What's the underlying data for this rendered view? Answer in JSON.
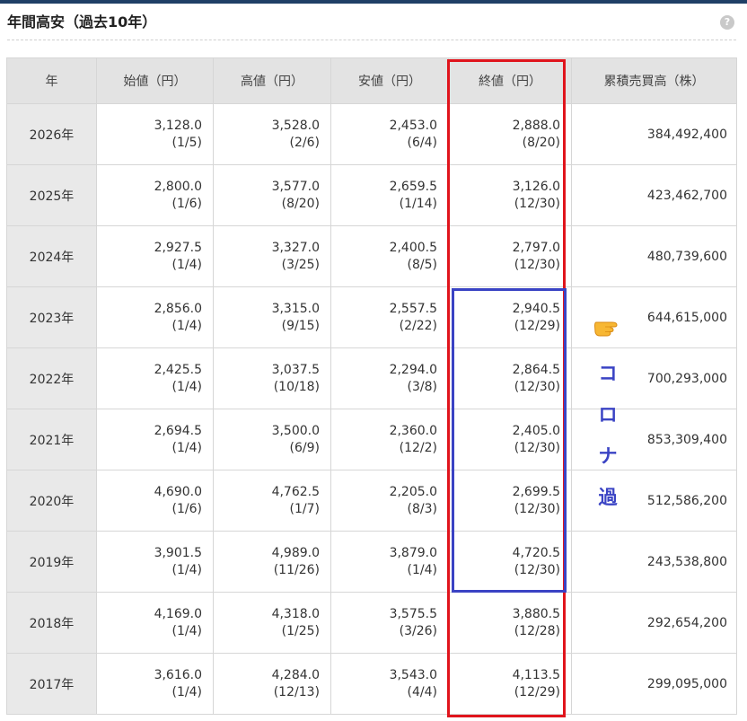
{
  "section": {
    "title": "年間高安（過去10年）",
    "help_label": "?"
  },
  "table": {
    "headers": [
      "年",
      "始値（円）",
      "高値（円）",
      "安値（円）",
      "終値（円）",
      "累積売買高（株）"
    ],
    "rows": [
      {
        "year": "2026年",
        "open": "3,128.0",
        "open_date": "(1/5)",
        "high": "3,528.0",
        "high_date": "(2/6)",
        "low": "2,453.0",
        "low_date": "(6/4)",
        "close": "2,888.0",
        "close_date": "(8/20)",
        "volume": "384,492,400"
      },
      {
        "year": "2025年",
        "open": "2,800.0",
        "open_date": "(1/6)",
        "high": "3,577.0",
        "high_date": "(8/20)",
        "low": "2,659.5",
        "low_date": "(1/14)",
        "close": "3,126.0",
        "close_date": "(12/30)",
        "volume": "423,462,700"
      },
      {
        "year": "2024年",
        "open": "2,927.5",
        "open_date": "(1/4)",
        "high": "3,327.0",
        "high_date": "(3/25)",
        "low": "2,400.5",
        "low_date": "(8/5)",
        "close": "2,797.0",
        "close_date": "(12/30)",
        "volume": "480,739,600"
      },
      {
        "year": "2023年",
        "open": "2,856.0",
        "open_date": "(1/4)",
        "high": "3,315.0",
        "high_date": "(9/15)",
        "low": "2,557.5",
        "low_date": "(2/22)",
        "close": "2,940.5",
        "close_date": "(12/29)",
        "volume": "644,615,000"
      },
      {
        "year": "2022年",
        "open": "2,425.5",
        "open_date": "(1/4)",
        "high": "3,037.5",
        "high_date": "(10/18)",
        "low": "2,294.0",
        "low_date": "(3/8)",
        "close": "2,864.5",
        "close_date": "(12/30)",
        "volume": "700,293,000"
      },
      {
        "year": "2021年",
        "open": "2,694.5",
        "open_date": "(1/4)",
        "high": "3,500.0",
        "high_date": "(6/9)",
        "low": "2,360.0",
        "low_date": "(12/2)",
        "close": "2,405.0",
        "close_date": "(12/30)",
        "volume": "853,309,400"
      },
      {
        "year": "2020年",
        "open": "4,690.0",
        "open_date": "(1/6)",
        "high": "4,762.5",
        "high_date": "(1/7)",
        "low": "2,205.0",
        "low_date": "(8/3)",
        "close": "2,699.5",
        "close_date": "(12/30)",
        "volume": "512,586,200"
      },
      {
        "year": "2019年",
        "open": "3,901.5",
        "open_date": "(1/4)",
        "high": "4,989.0",
        "high_date": "(11/26)",
        "low": "3,879.0",
        "low_date": "(1/4)",
        "close": "4,720.5",
        "close_date": "(12/30)",
        "volume": "243,538,800"
      },
      {
        "year": "2018年",
        "open": "4,169.0",
        "open_date": "(1/4)",
        "high": "4,318.0",
        "high_date": "(1/25)",
        "low": "3,575.5",
        "low_date": "(3/26)",
        "close": "3,880.5",
        "close_date": "(12/28)",
        "volume": "292,654,200"
      },
      {
        "year": "2017年",
        "open": "3,616.0",
        "open_date": "(1/4)",
        "high": "4,284.0",
        "high_date": "(12/13)",
        "low": "3,543.0",
        "low_date": "(4/4)",
        "close": "4,113.5",
        "close_date": "(12/29)",
        "volume": "299,095,000"
      }
    ]
  },
  "annotation": {
    "chars": [
      "コ",
      "ロ",
      "ナ",
      "過"
    ],
    "pointer_icon": "pointing-hand-icon",
    "red_box_color": "#e0141c",
    "blue_box_color": "#3a43c4",
    "text_color": "#3a43c4"
  }
}
